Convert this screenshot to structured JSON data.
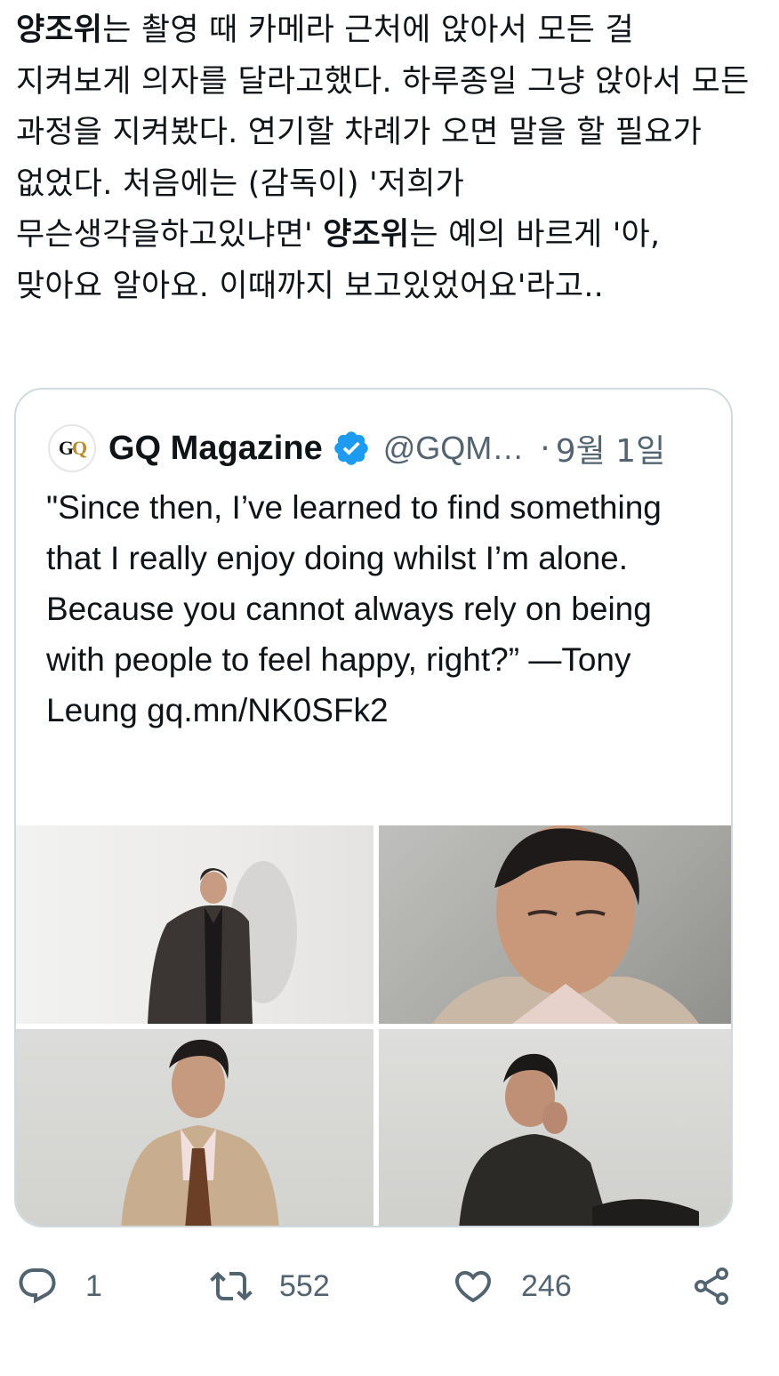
{
  "tweet": {
    "name_bold": "양조위",
    "text_1": "는 촬영 때 카메라 근처에 앉아서 모든 걸 지켜보게 의자를 달라고했다. 하루종일 그냥 앉아서 모든 과정을 지켜봤다. 연기할 차례가 오면 말을 할 필요가 없었다. 처음에는 (감독이) '저희가 무슨생각을하고있냐면' ",
    "name_bold_2": "양조위",
    "text_2": "는 예의 바르게 '아, 맞아요 알아요. 이때까지 보고있었어요'라고.."
  },
  "quote": {
    "avatar_g": "G",
    "avatar_q": "Q",
    "name": "GQ Magazine",
    "handle": "@GQM…",
    "separator": "·",
    "date": "9월 1일",
    "text": "\"Since then, I’ve learned to find something that I really enjoy doing whilst I’m alone. Because you cannot always rely on being with people to feel happy, right?” —Tony Leung gq.mn/NK0SFk2",
    "photo_count": 4
  },
  "actions": {
    "reply_count": "1",
    "retweet_count": "552",
    "like_count": "246"
  },
  "colors": {
    "text": "#0f1419",
    "secondary": "#536471",
    "border": "#cfd9de",
    "verified": "#1d9bf0"
  },
  "icons": [
    "reply-icon",
    "retweet-icon",
    "like-icon",
    "share-icon",
    "verified-icon"
  ]
}
